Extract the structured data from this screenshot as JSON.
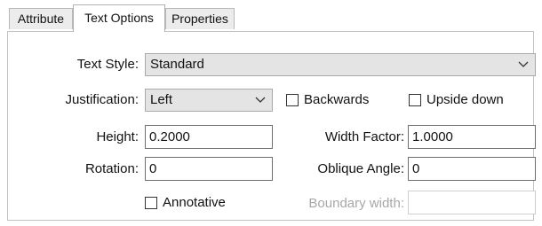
{
  "tabs": [
    {
      "label": "Attribute"
    },
    {
      "label": "Text Options"
    },
    {
      "label": "Properties"
    }
  ],
  "active_tab": "Text Options",
  "form": {
    "text_style": {
      "label": "Text Style:",
      "value": "Standard"
    },
    "justification": {
      "label": "Justification:",
      "value": "Left"
    },
    "backwards": {
      "label": "Backwards",
      "checked": false
    },
    "upside_down": {
      "label": "Upside down",
      "checked": false
    },
    "height": {
      "label": "Height:",
      "value": "0.2000"
    },
    "width_factor": {
      "label": "Width Factor:",
      "value": "1.0000"
    },
    "rotation": {
      "label": "Rotation:",
      "value": "0"
    },
    "oblique_angle": {
      "label": "Oblique Angle:",
      "value": "0"
    },
    "annotative": {
      "label": "Annotative",
      "checked": false
    },
    "boundary_width": {
      "label": "Boundary width:",
      "value": "",
      "enabled": false
    }
  },
  "icons": {
    "dropdown": "chevron-down-icon"
  }
}
